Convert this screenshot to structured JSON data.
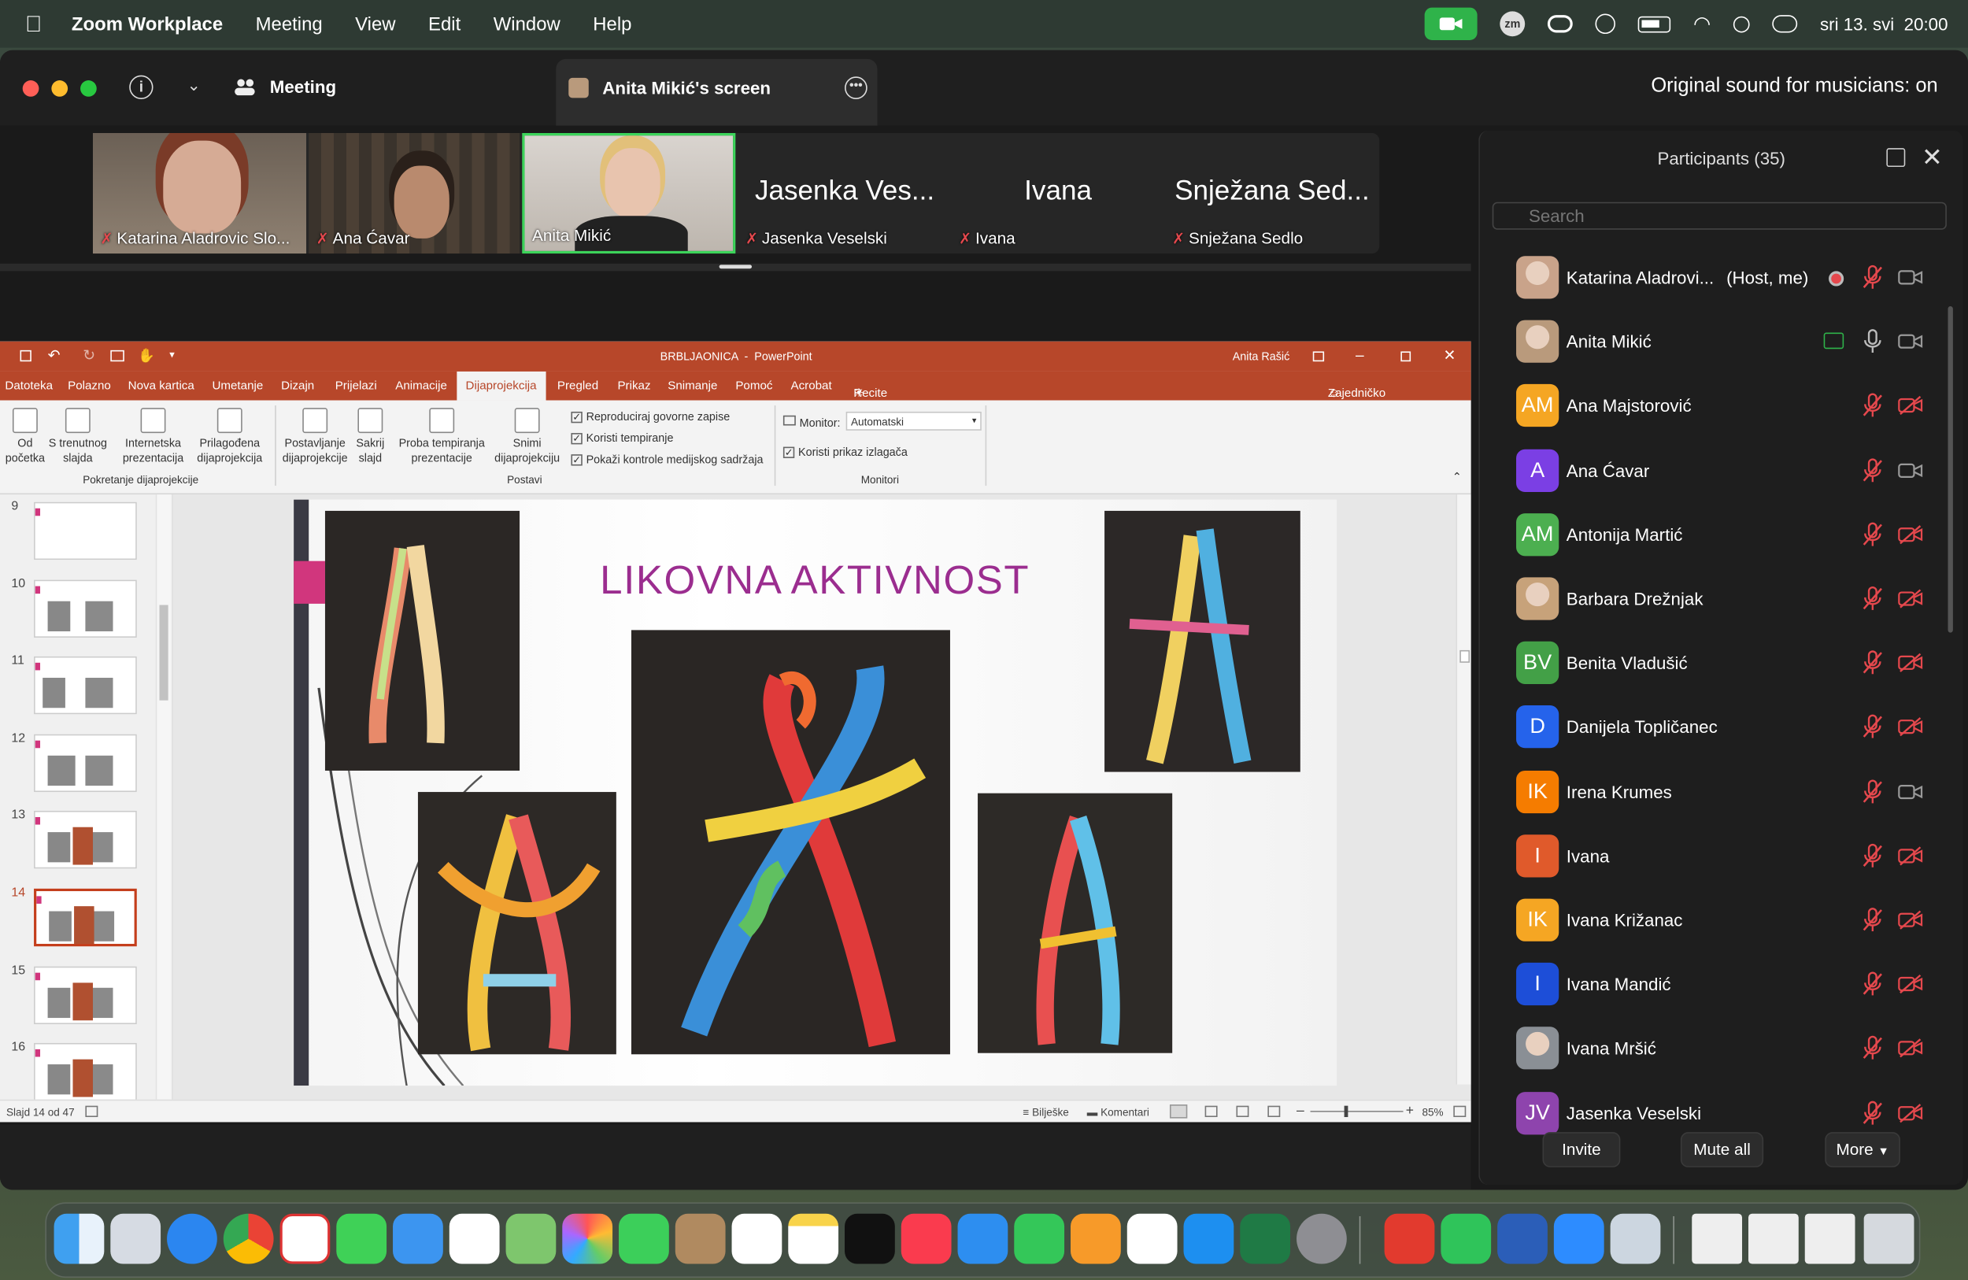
{
  "menubar": {
    "app_name": "Zoom Workplace",
    "menus": [
      "Meeting",
      "View",
      "Edit",
      "Window",
      "Help"
    ],
    "datetime": "sri 13. svi  20:00"
  },
  "zoom": {
    "meeting_label": "Meeting",
    "screen_tab": "Anita Mikić's screen",
    "original_sound": "Original sound for musicians: on",
    "gallery": [
      {
        "name": "Katarina Aladrovic Slo...",
        "muted": true
      },
      {
        "name": "Ana Ćavar",
        "muted": true
      },
      {
        "name": "Anita Mikić",
        "muted": false,
        "active": true
      },
      {
        "name": "Jasenka Veselski",
        "big": "Jasenka Ves...",
        "muted": true
      },
      {
        "name": "Ivana",
        "big": "Ivana",
        "muted": true
      },
      {
        "name": "Snježana Sedlo",
        "big": "Snježana Sed...",
        "muted": true
      }
    ],
    "participants": {
      "title": "Participants (35)",
      "search_placeholder": "Search",
      "list": [
        {
          "name": "Katarina Aladrovi...",
          "extra": "(Host, me)",
          "initials": "",
          "color": "#c9a38a",
          "photo": true,
          "mic": "muted",
          "cam": "off-grey"
        },
        {
          "name": "Anita Mikić",
          "extra": "",
          "initials": "",
          "color": "#b99a7c",
          "photo": true,
          "mic": "on",
          "cam": "off-grey",
          "sharing": true
        },
        {
          "name": "Ana Majstorović",
          "extra": "",
          "initials": "AM",
          "color": "#f5a623",
          "mic": "muted",
          "cam": "off"
        },
        {
          "name": "Ana Ćavar",
          "extra": "",
          "initials": "A",
          "color": "#7b3fe4",
          "mic": "muted",
          "cam": "off-grey"
        },
        {
          "name": "Antonija Martić",
          "extra": "",
          "initials": "AM",
          "color": "#4caf50",
          "mic": "muted",
          "cam": "off"
        },
        {
          "name": "Barbara Drežnjak",
          "extra": "",
          "initials": "",
          "color": "#c7a27a",
          "photo": true,
          "mic": "muted",
          "cam": "off"
        },
        {
          "name": "Benita Vladušić",
          "extra": "",
          "initials": "BV",
          "color": "#43a047",
          "mic": "muted",
          "cam": "off"
        },
        {
          "name": "Danijela Topličanec",
          "extra": "",
          "initials": "D",
          "color": "#2563eb",
          "mic": "muted",
          "cam": "off"
        },
        {
          "name": "Irena Krumes",
          "extra": "",
          "initials": "IK",
          "color": "#f57c00",
          "mic": "muted",
          "cam": "off-grey"
        },
        {
          "name": "Ivana",
          "extra": "",
          "initials": "I",
          "color": "#e05a2b",
          "mic": "muted",
          "cam": "off"
        },
        {
          "name": "Ivana Križanac",
          "extra": "",
          "initials": "IK",
          "color": "#f5a623",
          "mic": "muted",
          "cam": "off"
        },
        {
          "name": "Ivana Mandić",
          "extra": "",
          "initials": "I",
          "color": "#1d4ed8",
          "mic": "muted",
          "cam": "off"
        },
        {
          "name": "Ivana Mršić",
          "extra": "",
          "initials": "",
          "color": "#8a8f95",
          "photo": true,
          "mic": "muted",
          "cam": "off"
        },
        {
          "name": "Jasenka Veselski",
          "extra": "",
          "initials": "JV",
          "color": "#8e44ad",
          "mic": "muted",
          "cam": "off"
        }
      ],
      "buttons": {
        "invite": "Invite",
        "mute_all": "Mute all",
        "more": "More"
      }
    }
  },
  "ppt": {
    "title": "BRBLJAONICA  -  PowerPoint",
    "user": "Anita Rašić",
    "tabs": [
      "Datoteka",
      "Polazno",
      "Nova kartica",
      "Umetanje",
      "Dizajn",
      "Prijelazi",
      "Animacije",
      "Dijaprojekcija",
      "Pregled",
      "Prikaz",
      "Snimanje",
      "Pomoć",
      "Acrobat"
    ],
    "tell_me": "Recite što želite učiniti",
    "share": "Zajedničko korištenje",
    "ribbon": {
      "b_od_pocetka_1": "Od",
      "b_od_pocetka_2": "početka",
      "b_trenutni_1": "S trenutnog",
      "b_trenutni_2": "slajda",
      "b_internetska_1": "Internetska",
      "b_internetska_2": "prezentacija",
      "b_prilagodena_1": "Prilagođena",
      "b_prilagodena_2": "dijaprojekcija",
      "group1": "Pokretanje dijaprojekcije",
      "b_postavljanje_1": "Postavljanje",
      "b_postavljanje_2": "dijaprojekcije",
      "b_sakrij_1": "Sakrij",
      "b_sakrij_2": "slajd",
      "b_proba_1": "Proba tempiranja",
      "b_proba_2": "prezentacije",
      "b_snimi_1": "Snimi",
      "b_snimi_2": "dijaprojekciju",
      "chk1": "Reproduciraj govorne zapise",
      "chk2": "Koristi tempiranje",
      "chk3": "Pokaži kontrole medijskog sadržaja",
      "group2": "Postavi",
      "monitor_label": "Monitor:",
      "monitor_value": "Automatski",
      "chk4": "Koristi prikaz izlagača",
      "group3": "Monitori"
    },
    "slide_numbers": [
      "9",
      "10",
      "11",
      "12",
      "13",
      "14",
      "15",
      "16"
    ],
    "slide_title": "LIKOVNA AKTIVNOST",
    "status_left": "Slajd 14 od 47",
    "notes": "Bilješke",
    "comments": "Komentari",
    "zoom_level": "85%"
  },
  "colors": {
    "accent": "#b7472a",
    "slide_title": "#9b2d8f",
    "mute_red": "#e5484d",
    "zoom_green": "#2fb34a"
  }
}
